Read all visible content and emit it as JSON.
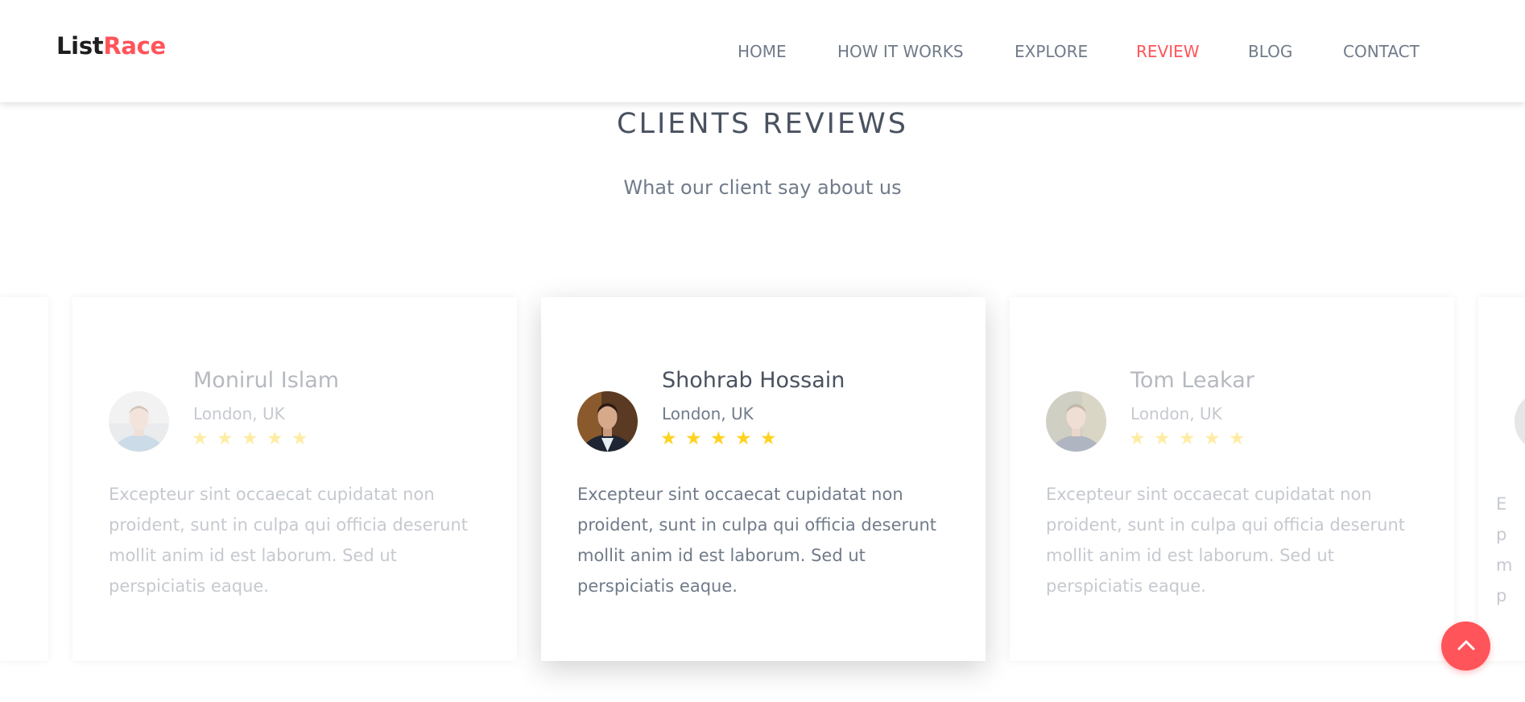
{
  "brand": {
    "part1": "List",
    "part2": "Race",
    "accent_color": "#ff545a"
  },
  "nav": [
    {
      "label": "HOME",
      "active": false
    },
    {
      "label": "HOW IT WORKS",
      "active": false
    },
    {
      "label": "EXPLORE",
      "active": false
    },
    {
      "label": "REVIEW",
      "active": true
    },
    {
      "label": "BLOG",
      "active": false
    },
    {
      "label": "CONTACT",
      "active": false
    }
  ],
  "section": {
    "title": "CLIENTS REVIEWS",
    "subtitle": "What our client say about us"
  },
  "reviews": [
    {
      "name": "Monirul Islam",
      "location": "London, UK",
      "rating": 5,
      "text": "Excepteur sint occaecat cupidatat non proident, sunt in culpa qui officia deserunt mollit anim id est laborum. Sed ut perspiciatis eaque.",
      "state": "faded"
    },
    {
      "name": "Shohrab Hossain",
      "location": "London, UK",
      "rating": 5,
      "text": "Excepteur sint occaecat cupidatat non proident, sunt in culpa qui officia deserunt mollit anim id est laborum. Sed ut perspiciatis eaque.",
      "state": "active"
    },
    {
      "name": "Tom Leakar",
      "location": "London, UK",
      "rating": 5,
      "text": "Excepteur sint occaecat cupidatat non proident, sunt in culpa qui officia deserunt mollit anim id est laborum. Sed ut perspiciatis eaque.",
      "state": "faded"
    }
  ],
  "edge_fragment": [
    "E",
    "p",
    "m",
    "p"
  ],
  "star_glyph": "★",
  "star_color": "#ffd21f",
  "back_to_top_icon": "chevron-up-icon"
}
